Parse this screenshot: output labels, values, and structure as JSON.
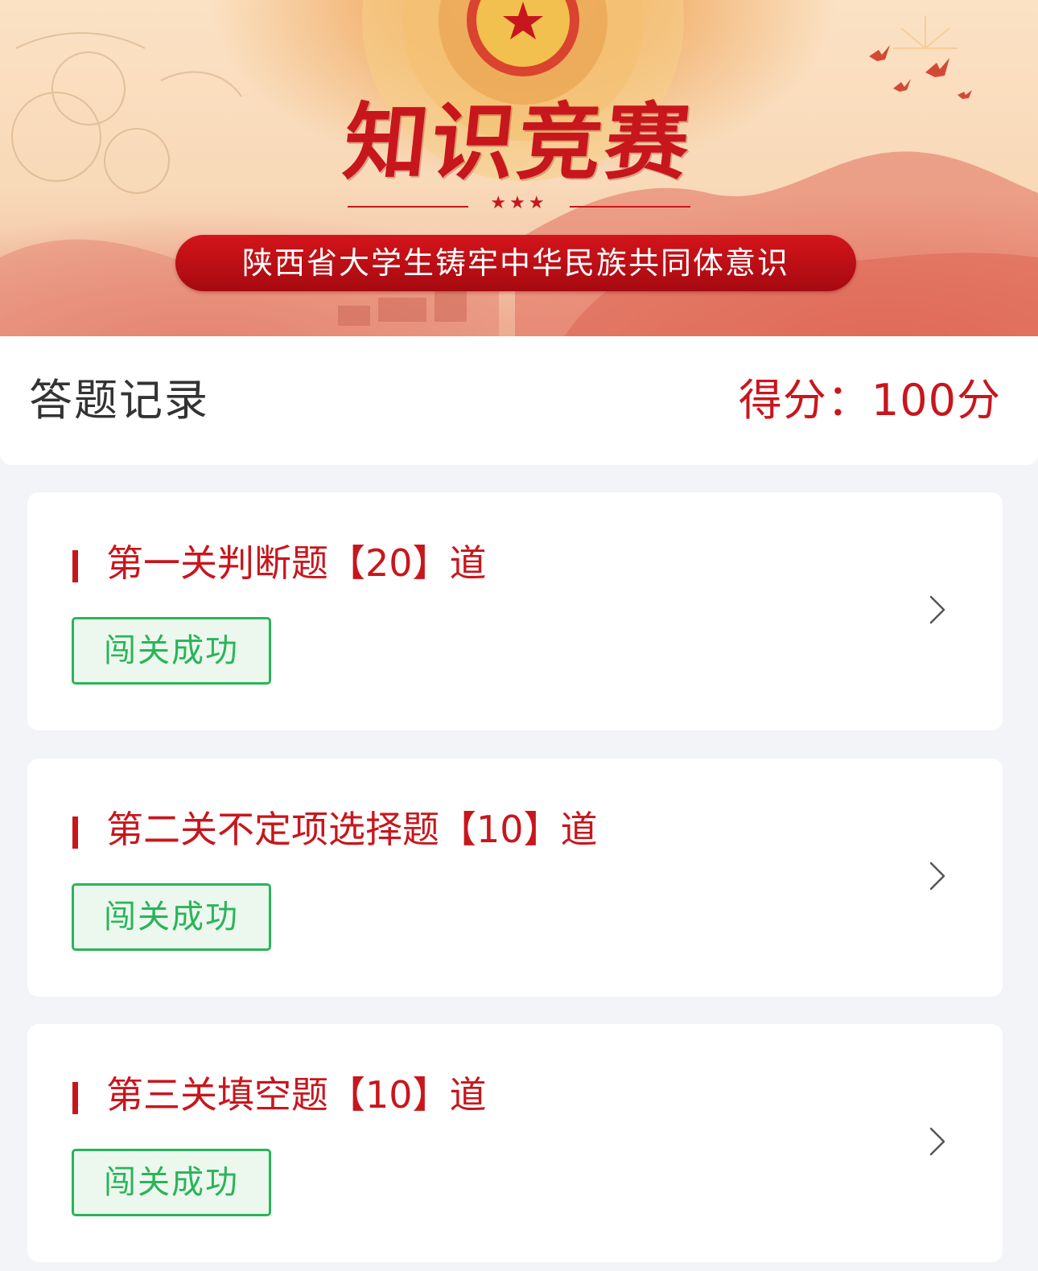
{
  "banner": {
    "title": "知识竞赛",
    "stars": "★★★",
    "subtitle": "陕西省大学生铸牢中华民族共同体意识"
  },
  "header": {
    "title": "答题记录",
    "score_label": "得分：",
    "score_value": "100分"
  },
  "levels": [
    {
      "title": "第一关判断题【20】道",
      "status": "闯关成功"
    },
    {
      "title": "第二关不定项选择题【10】道",
      "status": "闯关成功"
    },
    {
      "title": "第三关填空题【10】道",
      "status": "闯关成功"
    }
  ],
  "colors": {
    "accent_red": "#c8161d",
    "success_green": "#2ab45a",
    "success_bg": "#ecf8ee",
    "page_bg": "#f2f4f8"
  },
  "icons": {
    "chevron": "chevron-right-icon",
    "emblem": "star-emblem-icon",
    "bird": "bird-icon"
  }
}
